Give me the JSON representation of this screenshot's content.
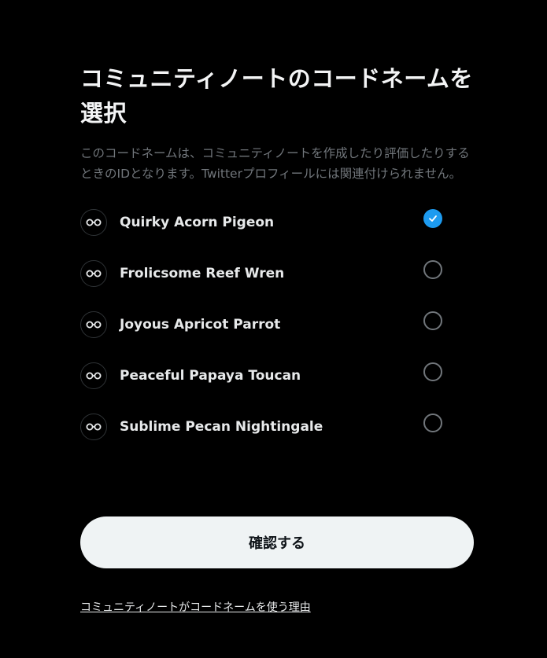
{
  "header": {
    "title": "コミュニティノートのコードネームを選択"
  },
  "description": "このコードネームは、コミュニティノートを作成したり評価したりするときのIDとなります。Twitterプロフィールには関連付けられません。",
  "options": [
    {
      "label": "Quirky Acorn Pigeon",
      "selected": true
    },
    {
      "label": "Frolicsome Reef Wren",
      "selected": false
    },
    {
      "label": "Joyous Apricot Parrot",
      "selected": false
    },
    {
      "label": "Peaceful Papaya Toucan",
      "selected": false
    },
    {
      "label": "Sublime Pecan Nightingale",
      "selected": false
    }
  ],
  "confirm_button": {
    "label": "確認する"
  },
  "reason_link": {
    "label": "コミュニティノートがコードネームを使う理由"
  },
  "colors": {
    "background": "#000000",
    "accent": "#1d9bf0",
    "button_bg": "#eff3f4",
    "muted_text": "#71767b"
  },
  "icons": {
    "badge": "anonymous-glasses-icon",
    "check": "checkmark-icon"
  }
}
